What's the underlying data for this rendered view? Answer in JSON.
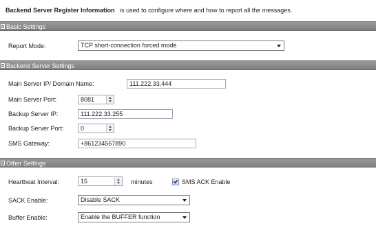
{
  "intro": {
    "bold": "Backend Server Register Information",
    "text": "is used to configure where and how to report all the messages."
  },
  "sections": {
    "basic": {
      "title": "Basic Settings"
    },
    "backend": {
      "title": "Backend Server Settings"
    },
    "other": {
      "title": "Other Settings"
    }
  },
  "basic": {
    "report_mode_label": "Report Mode:",
    "report_mode_value": "TCP short-connection forced mode"
  },
  "backend": {
    "main_server_label": "Main Server IP/ Domain Name:",
    "main_server_value": "111.222.33.444",
    "main_port_label": "Main Server Port:",
    "main_port_value": "8081",
    "backup_ip_label": "Backup Server IP:",
    "backup_ip_value": "111.222.33.255",
    "backup_port_label": "Backup Server Port:",
    "backup_port_value": "0",
    "sms_gateway_label": "SMS Gateway:",
    "sms_gateway_value": "+861234567890"
  },
  "other": {
    "heartbeat_label": "Heartbeat Interval:",
    "heartbeat_value": "15",
    "heartbeat_unit": "minutes",
    "sms_ack_label": "SMS ACK Enable",
    "sms_ack_checked": true,
    "sack_label": "SACK Enable:",
    "sack_value": "Disable SACK",
    "buffer_label": "Buffer Enable:",
    "buffer_value": "Enable the BUFFER function"
  },
  "colors": {
    "section_header_bg": "#8a8a8a",
    "input_border": "#9ca6b3"
  }
}
